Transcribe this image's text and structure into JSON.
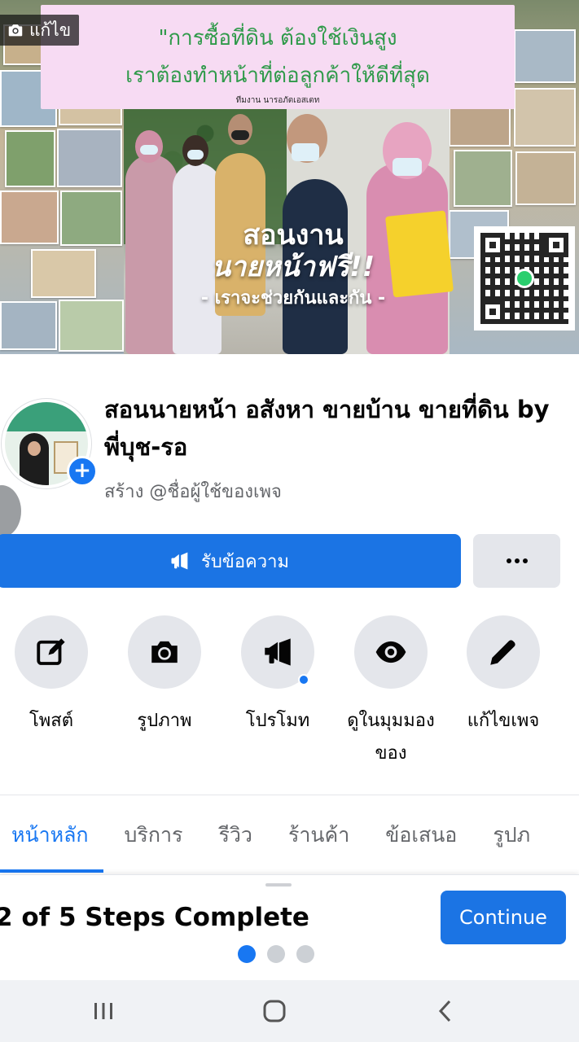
{
  "cover": {
    "edit_label": "แก้ไข",
    "banner_line1": "\"การซื้อที่ดิน ต้องใช้เงินสูง",
    "banner_line2": "เราต้องทำหน้าที่ต่อลูกค้าให้ดีที่สุด",
    "banner_small": "ทีมงาน นารอภัตเอสเตท",
    "headline_line1": "สอนงาน",
    "headline_line2": "นายหน้าฟรี!!",
    "headline_line3": "- เราจะช่วยกันและกัน -"
  },
  "profile": {
    "title": "สอนนายหน้า อสังหา ขายบ้าน ขายที่ดิน by พี่บุช-รอ",
    "username_prompt": "สร้าง @ชื่อผู้ใช้ของเพจ"
  },
  "buttons": {
    "message": "รับข้อความ"
  },
  "actions": [
    {
      "label": "โพสต์",
      "icon": "compose-icon"
    },
    {
      "label": "รูปภาพ",
      "icon": "camera-icon"
    },
    {
      "label": "โปรโมท",
      "icon": "megaphone-icon"
    },
    {
      "label": "ดูในมุมมองของ",
      "icon": "eye-icon"
    },
    {
      "label": "แก้ไขเพจ",
      "icon": "pencil-icon"
    }
  ],
  "tabs": [
    {
      "label": "หน้าหลัก",
      "active": true
    },
    {
      "label": "บริการ",
      "active": false
    },
    {
      "label": "รีวิว",
      "active": false
    },
    {
      "label": "ร้านค้า",
      "active": false
    },
    {
      "label": "ข้อเสนอ",
      "active": false
    },
    {
      "label": "รูปภ",
      "active": false
    }
  ],
  "setup_sheet": {
    "progress_text": "2 of 5 Steps Complete",
    "steps_done": 2,
    "steps_total": 5,
    "continue_label": "Continue",
    "pager_active_index": 0,
    "pager_count": 3
  },
  "colors": {
    "accent": "#1877f2",
    "button_blue": "#1b74e4",
    "banner_green": "#2f9a4a",
    "banner_pink": "#f7dbf3"
  }
}
